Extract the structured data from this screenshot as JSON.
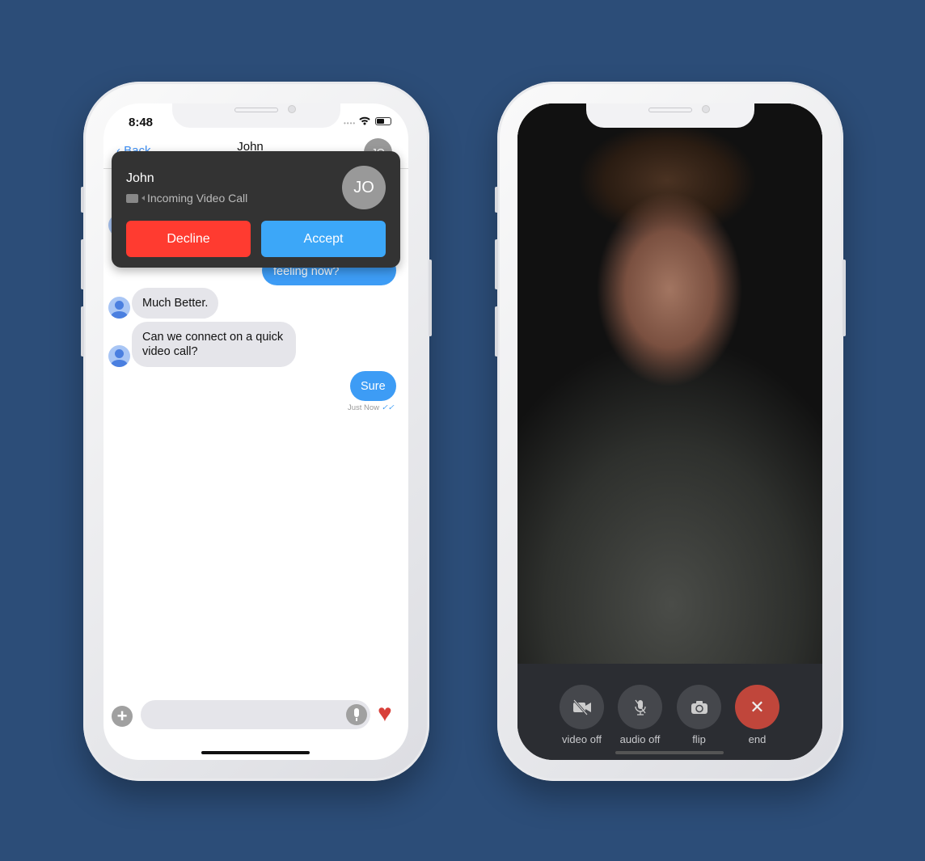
{
  "chat_phone": {
    "status": {
      "time": "8:48"
    },
    "nav": {
      "back": "Back",
      "title": "John",
      "avatar": "JO"
    },
    "incoming_call": {
      "caller": "John",
      "subtitle": "Incoming Video Call",
      "avatar": "JO",
      "decline": "Decline",
      "accept": "Accept",
      "decline_color": "#ff3b30",
      "accept_color": "#3ca7f8"
    },
    "messages": [
      {
        "dir": "out",
        "text": "feeling now?"
      },
      {
        "dir": "in",
        "text": "Much Better."
      },
      {
        "dir": "in",
        "text": "Can we connect on a quick video call?"
      },
      {
        "dir": "out",
        "text": "Sure",
        "meta": "Just Now"
      }
    ],
    "composer": {
      "placeholder": "",
      "add_icon": "plus-icon",
      "mic_icon": "mic-icon",
      "like_icon": "heart-icon"
    }
  },
  "video_phone": {
    "controls": [
      {
        "label": "video off",
        "icon": "video-off-icon"
      },
      {
        "label": "audio off",
        "icon": "mic-off-icon"
      },
      {
        "label": "flip",
        "icon": "camera-flip-icon"
      },
      {
        "label": "end",
        "icon": "close-icon",
        "color": "#c0463b"
      }
    ]
  }
}
